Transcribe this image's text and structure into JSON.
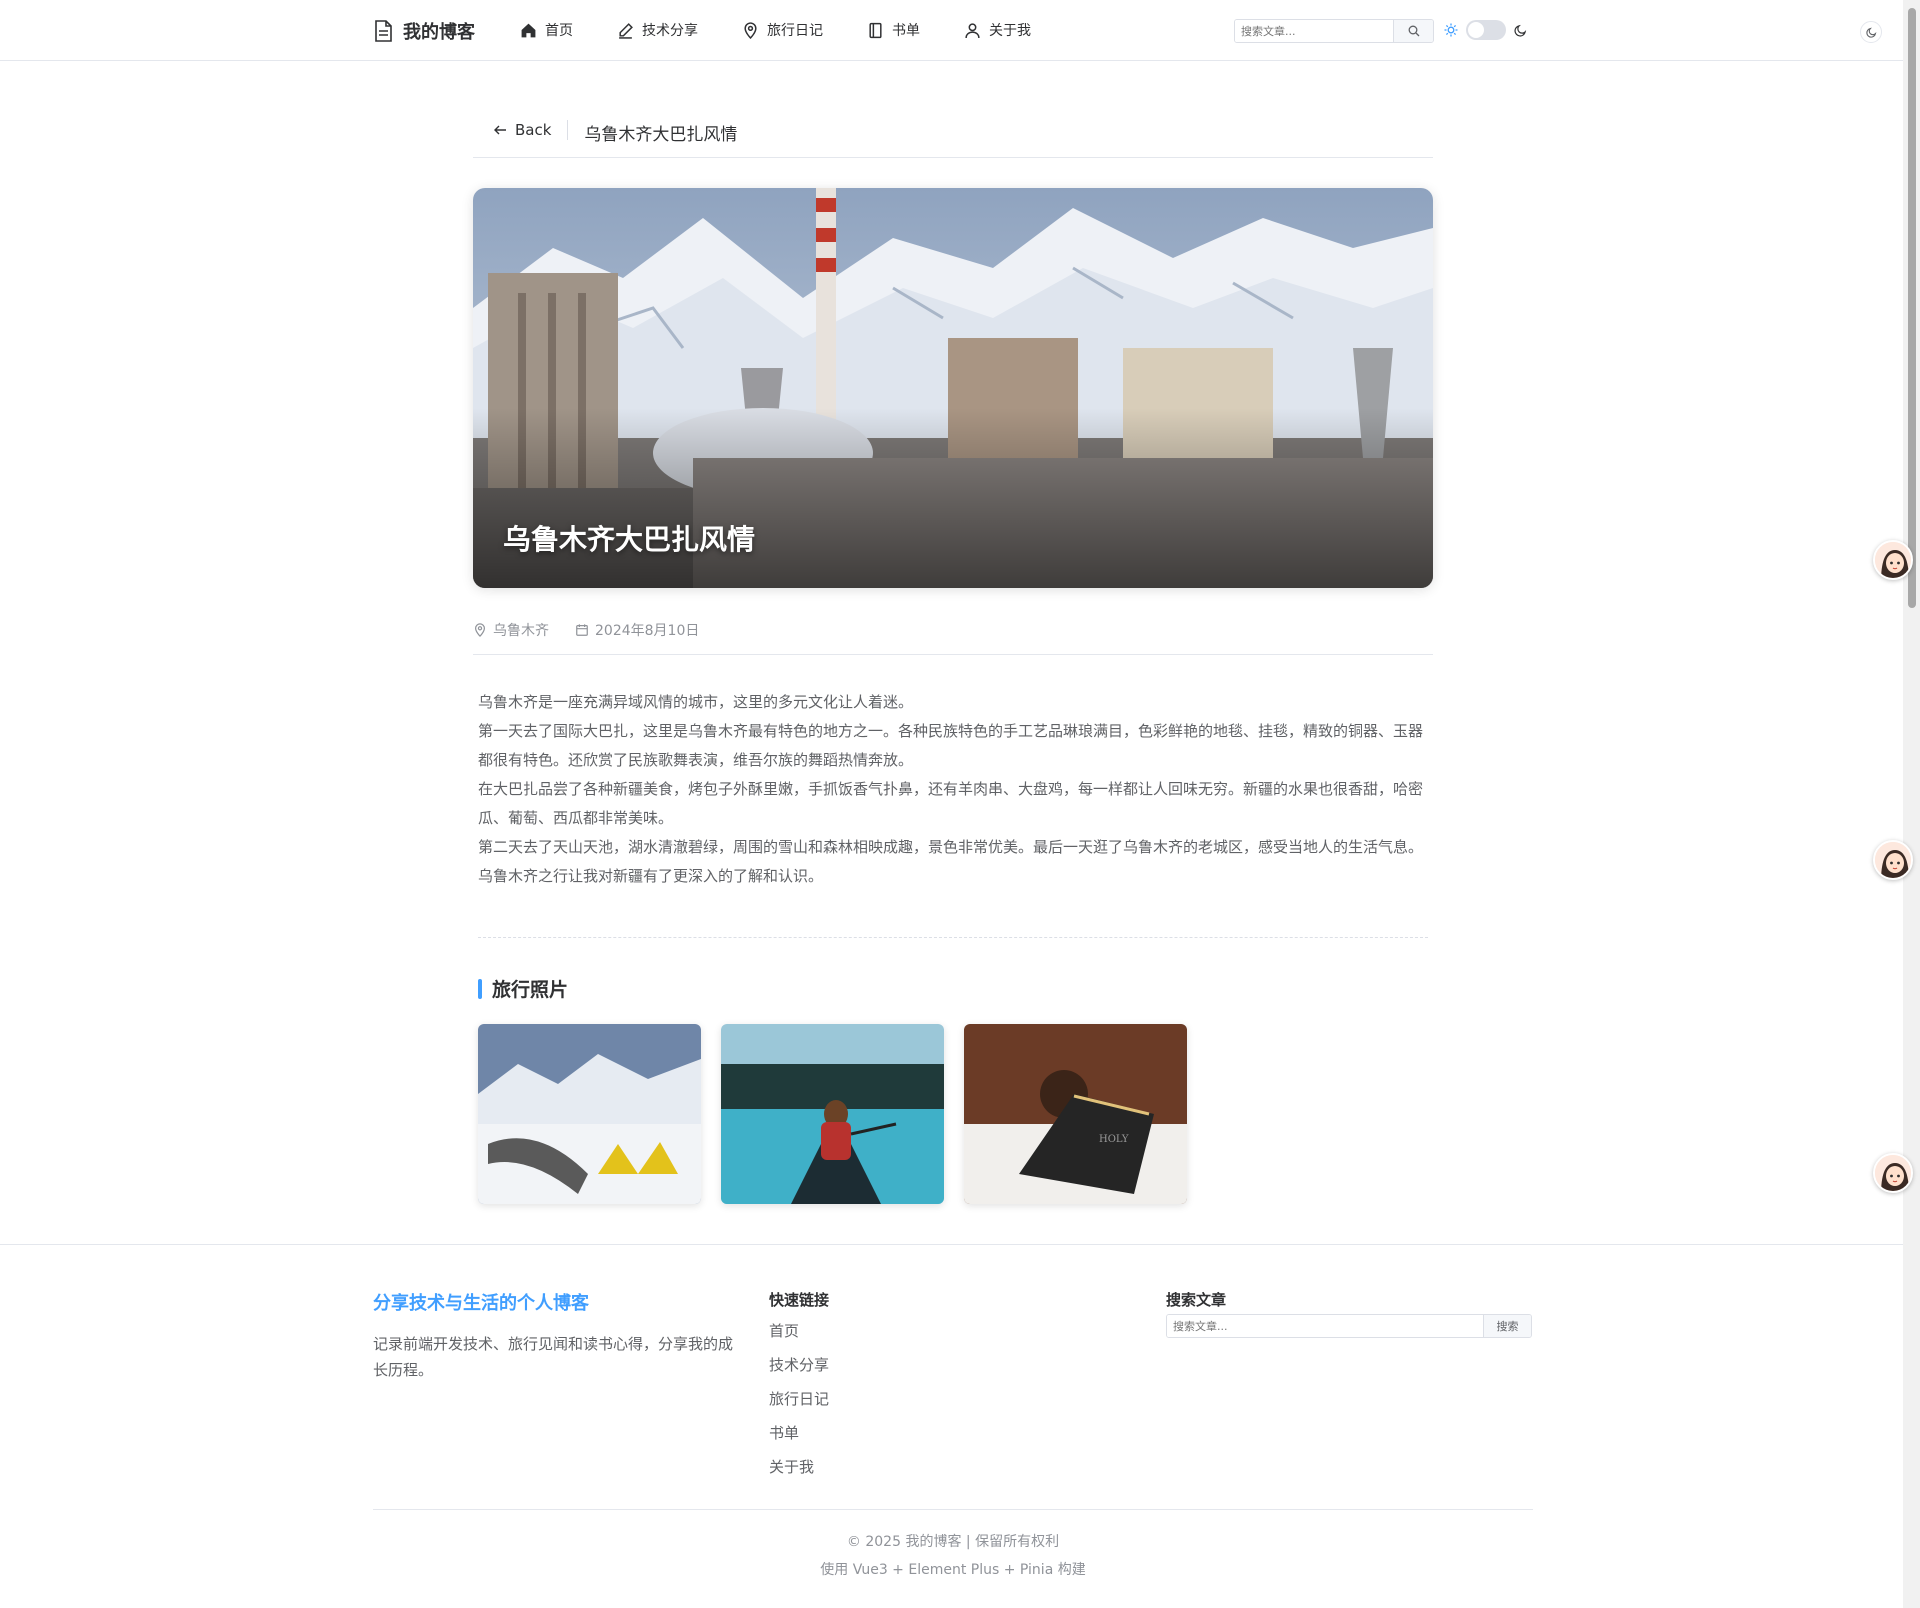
{
  "header": {
    "site_title": "我的博客",
    "nav": [
      {
        "label": "首页",
        "icon": "home-icon"
      },
      {
        "label": "技术分享",
        "icon": "edit-pen-icon"
      },
      {
        "label": "旅行日记",
        "icon": "location-icon"
      },
      {
        "label": "书单",
        "icon": "book-icon"
      },
      {
        "label": "关于我",
        "icon": "user-icon"
      }
    ],
    "search_placeholder": "搜索文章...",
    "theme_toggle": {
      "state": "light",
      "light_icon": "sun-icon",
      "dark_icon": "moon-icon"
    }
  },
  "page_header": {
    "back_label": "Back",
    "title": "乌鲁木齐大巴扎风情"
  },
  "article": {
    "hero_title": "乌鲁木齐大巴扎风情",
    "location": "乌鲁木齐",
    "date": "2024年8月10日",
    "paragraphs": [
      "乌鲁木齐是一座充满异域风情的城市，这里的多元文化让人着迷。",
      "第一天去了国际大巴扎，这里是乌鲁木齐最有特色的地方之一。各种民族特色的手工艺品琳琅满目，色彩鲜艳的地毯、挂毯，精致的铜器、玉器都很有特色。还欣赏了民族歌舞表演，维吾尔族的舞蹈热情奔放。",
      "在大巴扎品尝了各种新疆美食，烤包子外酥里嫩，手抓饭香气扑鼻，还有羊肉串、大盘鸡，每一样都让人回味无穷。新疆的水果也很香甜，哈密瓜、葡萄、西瓜都非常美味。",
      "第二天去了天山天池，湖水清澈碧绿，周围的雪山和森林相映成趣，景色非常优美。最后一天逛了乌鲁木齐的老城区，感受当地人的生活气息。乌鲁木齐之行让我对新疆有了更深入的了解和认识。"
    ],
    "photos_title": "旅行照片"
  },
  "footer": {
    "about_title": "分享技术与生活的个人博客",
    "about_text": "记录前端开发技术、旅行见闻和读书心得，分享我的成长历程。",
    "links_title": "快速链接",
    "links": [
      "首页",
      "技术分享",
      "旅行日记",
      "书单",
      "关于我"
    ],
    "search_title": "搜索文章",
    "search_placeholder": "搜索文章...",
    "search_button": "搜索",
    "copyright": "© 2025 我的博客 | 保留所有权利",
    "built_with": "使用 Vue3 + Element Plus + Pinia 构建"
  },
  "colors": {
    "accent": "#409eff",
    "text_primary": "#303133",
    "text_regular": "#606266",
    "text_secondary": "#909399",
    "border": "#e4e7ed"
  }
}
